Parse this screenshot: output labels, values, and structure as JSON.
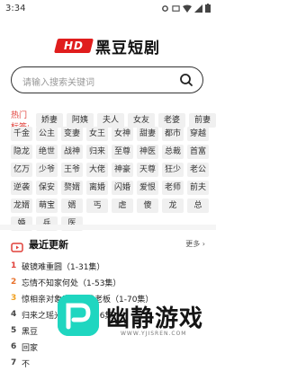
{
  "status_bar": {
    "time": "3:34"
  },
  "app": {
    "logo_badge": "HD",
    "logo_text": "黑豆短剧"
  },
  "search": {
    "placeholder": "请输入搜索关键词"
  },
  "hot_tags": {
    "title": "热门标签:",
    "first_row": [
      "娇妻",
      "阿姨",
      "夫人",
      "女友",
      "老婆",
      "前妻"
    ],
    "grid": [
      "千金",
      "公主",
      "变妻",
      "女王",
      "女神",
      "甜妻",
      "都市",
      "穿越",
      "隐龙",
      "绝世",
      "战神",
      "归来",
      "至尊",
      "神医",
      "总裁",
      "首富",
      "亿万",
      "少爷",
      "王爷",
      "大佬",
      "神豪",
      "天尊",
      "狂少",
      "老公",
      "逆袭",
      "保安",
      "赘婿",
      "离婚",
      "闪婚",
      "爱恨",
      "老师",
      "前夫",
      "龙婿",
      "萌宝",
      "婿",
      "丐",
      "虐",
      "傻",
      "龙",
      "总",
      "婚",
      "兵",
      "医"
    ]
  },
  "latest": {
    "title": "最近更新",
    "more_label": "更多",
    "items": [
      {
        "rank": "1",
        "text": "破镜难重圆（1-31集）"
      },
      {
        "rank": "2",
        "text": "忘情不知家何处（1-53集）"
      },
      {
        "rank": "3",
        "text": "惊相亲对象竟然是我老板（1-70集）"
      },
      {
        "rank": "4",
        "text": "归来之瑶光绽华（1-56集）"
      },
      {
        "rank": "5",
        "text": "黑豆"
      },
      {
        "rank": "6",
        "text": "回家"
      },
      {
        "rank": "7",
        "text": "不"
      }
    ]
  },
  "watermark": {
    "text": "幽静游戏",
    "url": "WWW.YJISREN.COM"
  },
  "colors": {
    "brand_red": "#e01d1d",
    "hot_red": "#e0403a",
    "teal": "#1fd6c0"
  }
}
